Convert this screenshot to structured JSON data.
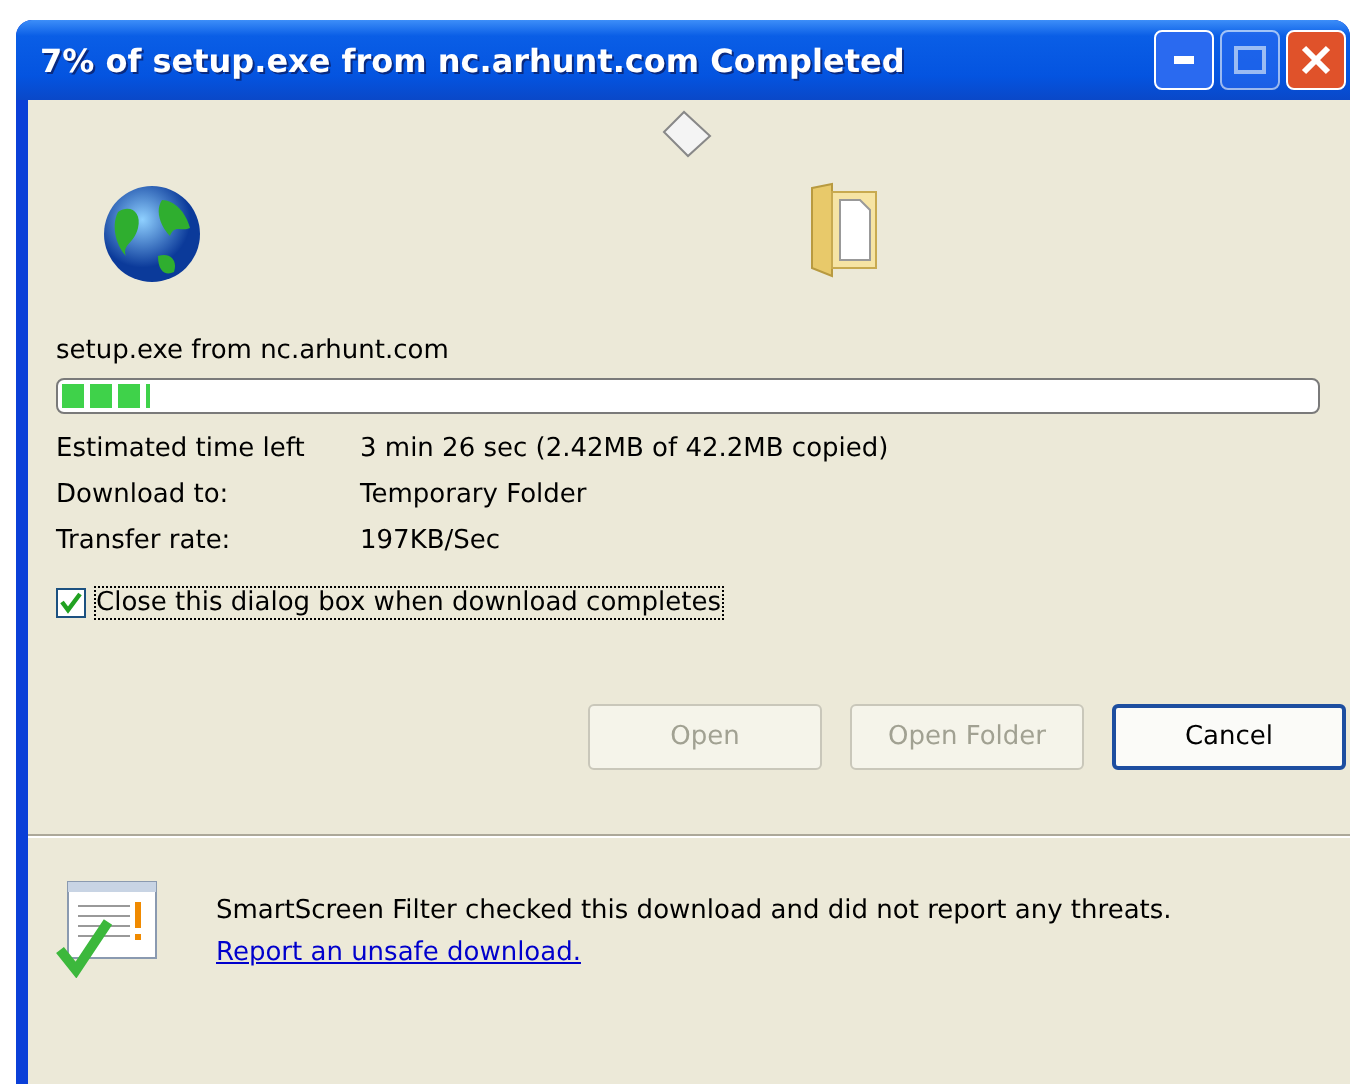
{
  "window": {
    "title": "7% of setup.exe from nc.arhunt.com Completed"
  },
  "download": {
    "file": "setup.exe from nc.arhunt.com",
    "level": 0.07
  },
  "details": [
    {
      "label": "Estimated time left",
      "value": "3 min 26 sec (2.42MB of 42.2MB copied)"
    },
    {
      "label": "Download to:",
      "value": "Temporary Folder"
    },
    {
      "label": "Transfer rate:",
      "value": "197KB/Sec"
    }
  ],
  "close_when_done": {
    "label": "Close this dialog box when download completes",
    "checked": true
  },
  "buttons": [
    {
      "label": "Open",
      "disabled": true,
      "default": false
    },
    {
      "label": "Open Folder",
      "disabled": true,
      "default": false
    },
    {
      "label": "Cancel",
      "disabled": false,
      "default": true
    }
  ],
  "smartscreen": {
    "text": "SmartScreen Filter checked this download and did not report any threats.",
    "link": "Report an unsafe download."
  }
}
